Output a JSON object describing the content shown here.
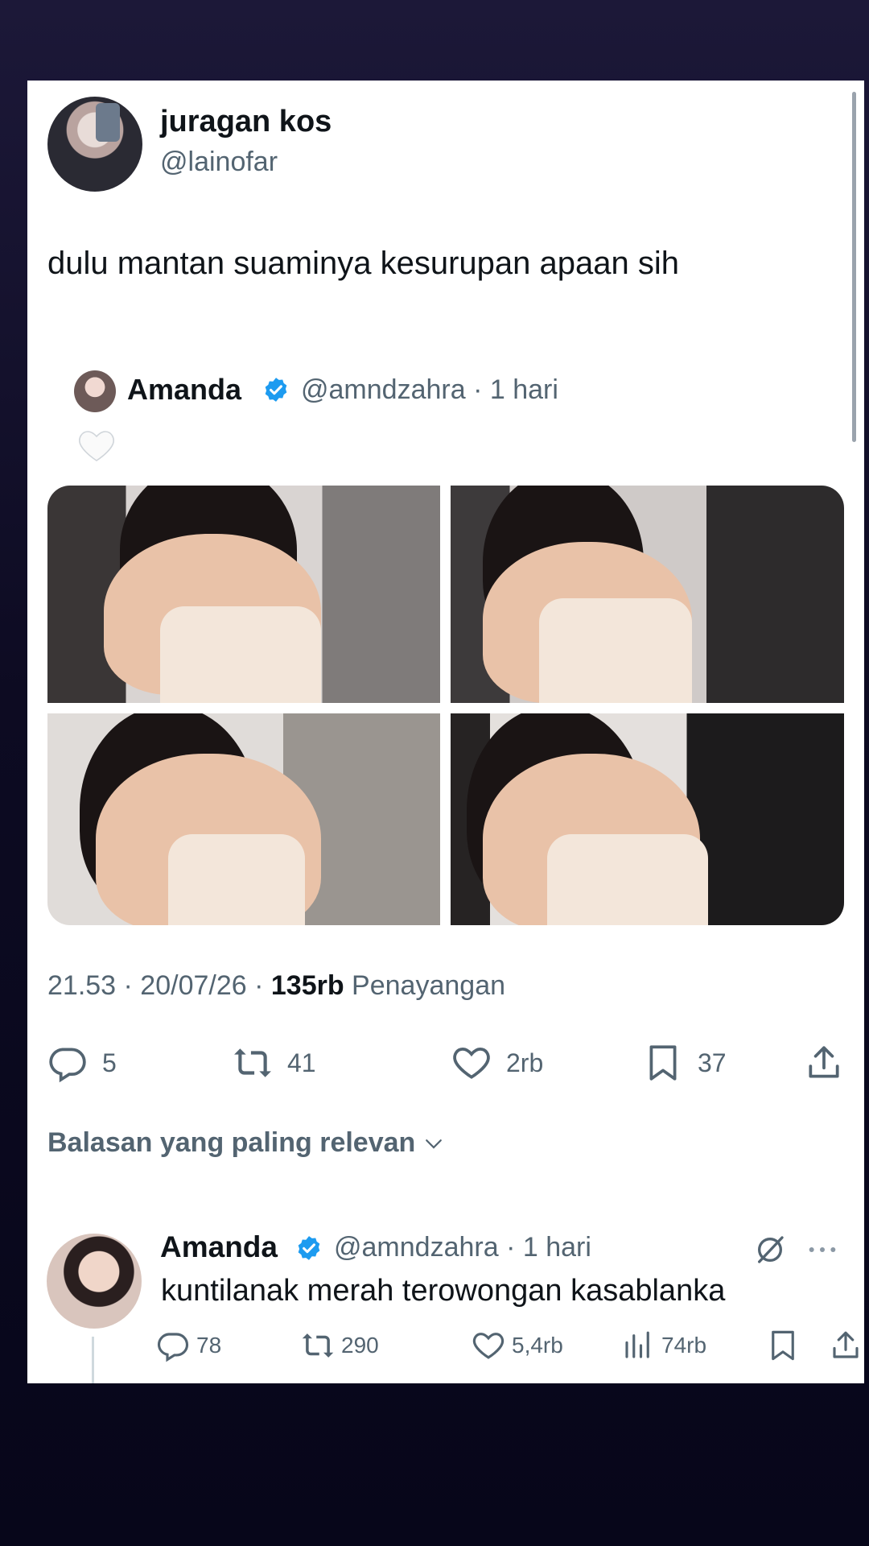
{
  "main_tweet": {
    "display_name": "juragan kos",
    "handle": "@lainofar",
    "text": "dulu mantan suaminya kesurupan apaan sih"
  },
  "quoted": {
    "display_name": "Amanda",
    "handle": "@amndzahra",
    "time": "· 1 hari",
    "verified": true,
    "emoji": "white-heart"
  },
  "meta": {
    "time": "21.53 · 20/07/26 · ",
    "views_count": "135rb",
    "views_label": " Penayangan"
  },
  "actions": {
    "replies": "5",
    "retweets": "41",
    "likes": "2rb",
    "bookmarks": "37"
  },
  "sort_label": "Balasan yang paling relevan",
  "reply": {
    "display_name": "Amanda",
    "handle": "@amndzahra",
    "time": "· 1 hari",
    "verified": true,
    "text": "kuntilanak merah terowongan kasablanka",
    "replies": "78",
    "retweets": "290",
    "likes": "5,4rb",
    "views": "74rb"
  },
  "colors": {
    "accent": "#1d9bf0",
    "text": "#0f1419",
    "muted": "#536471"
  }
}
